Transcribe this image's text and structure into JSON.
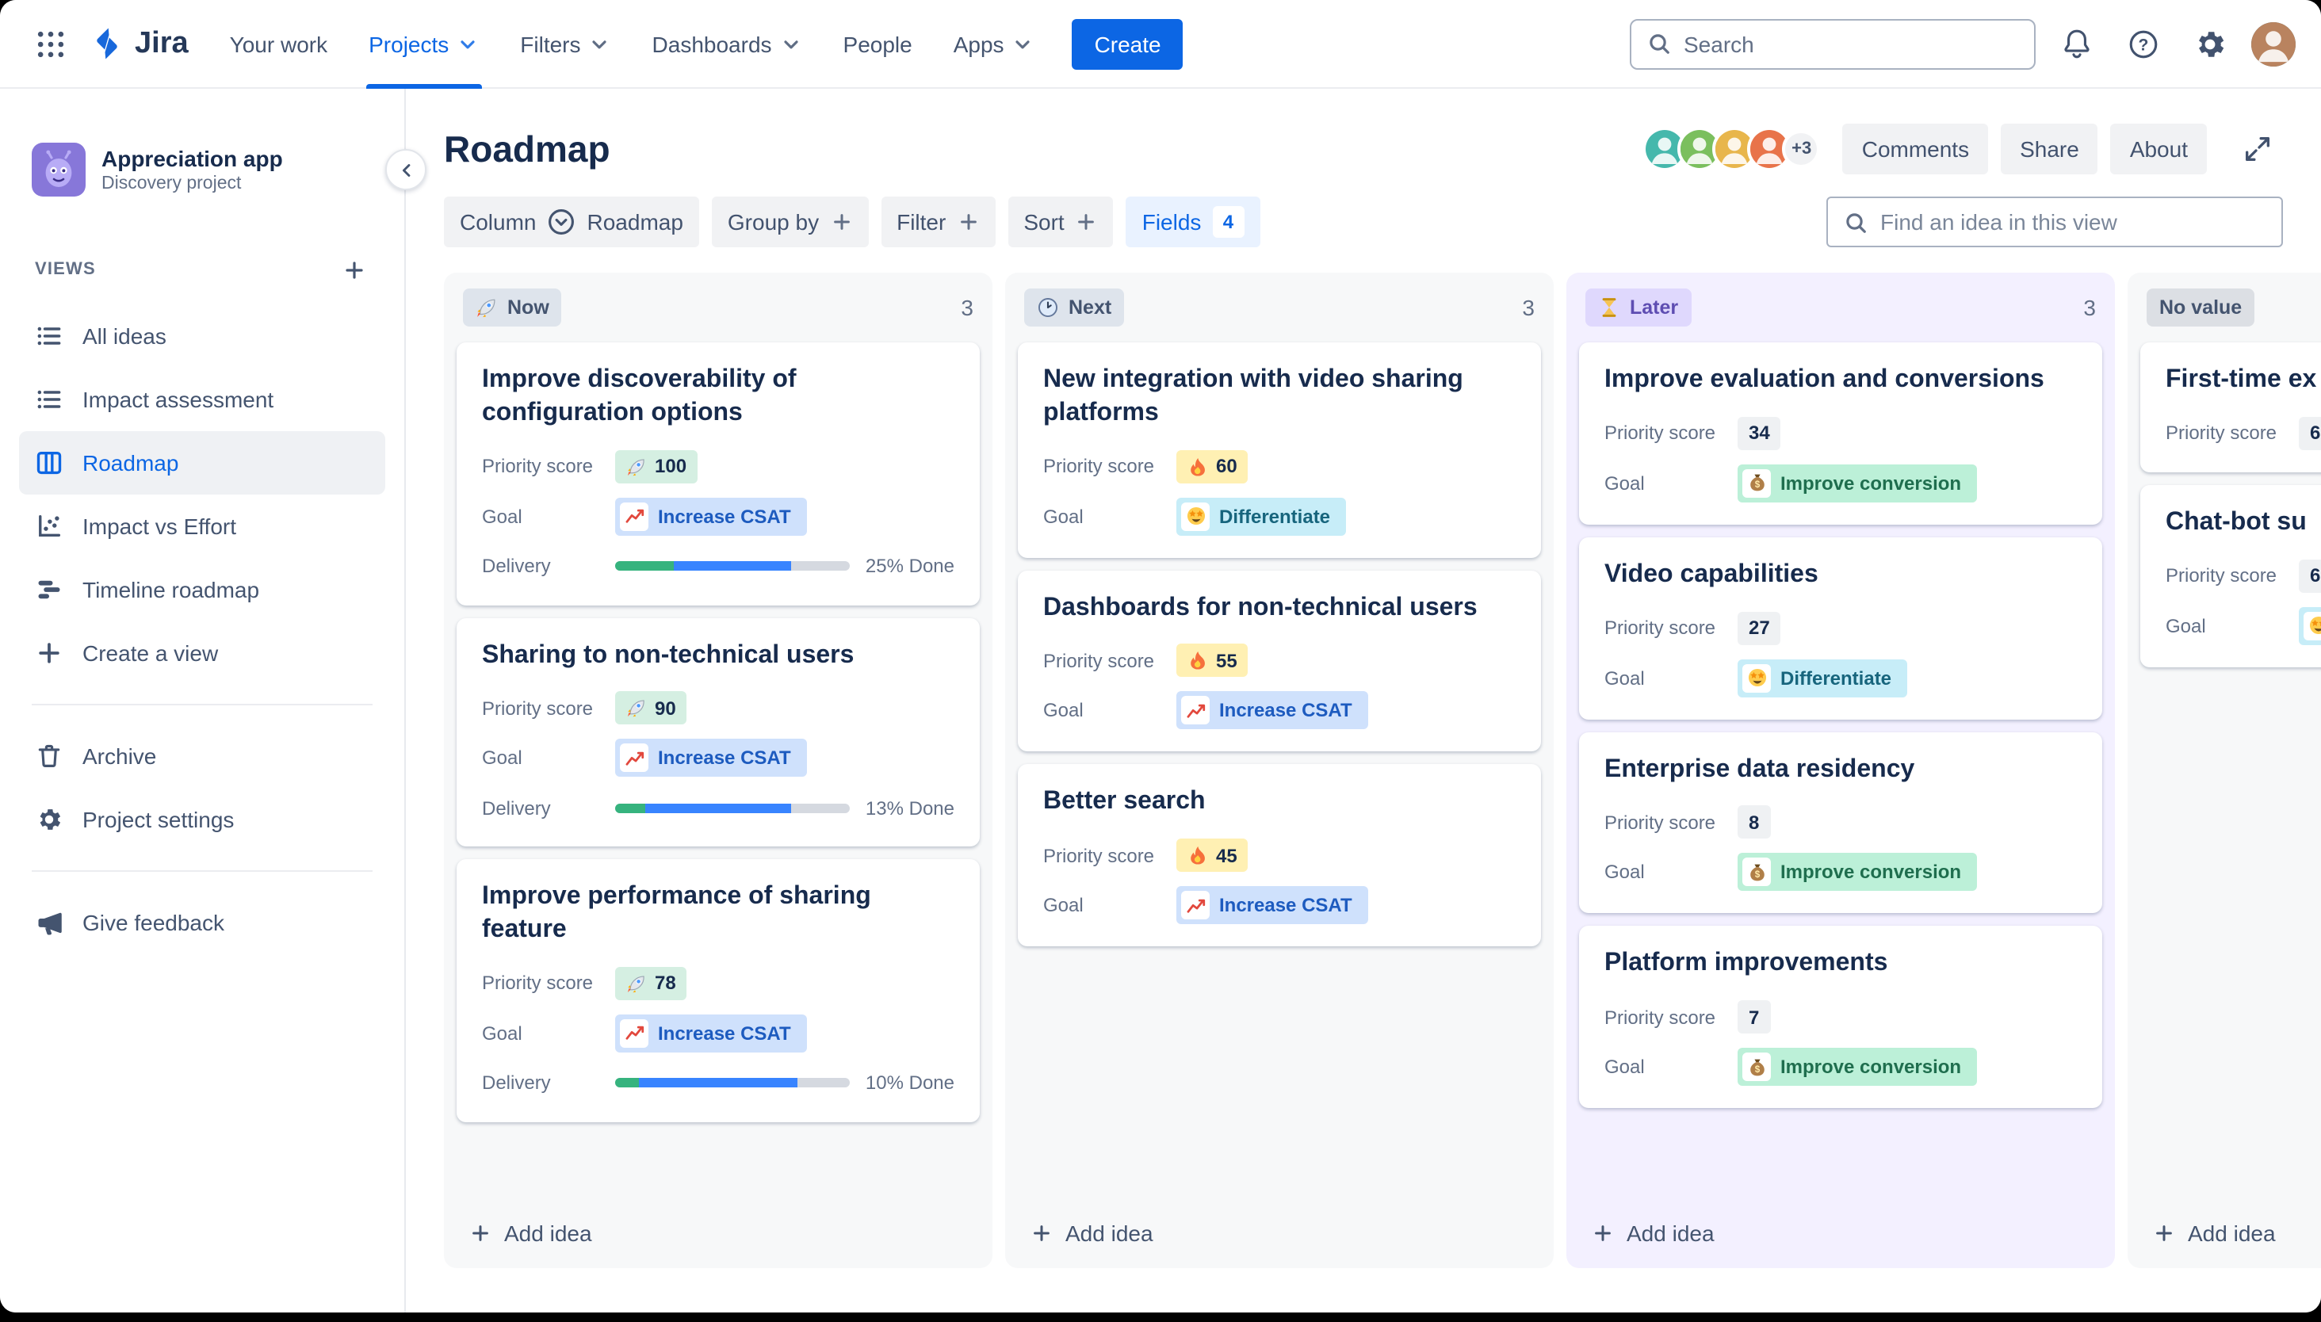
{
  "navbar": {
    "logo": "Jira",
    "items": [
      {
        "label": "Your work",
        "dropdown": false
      },
      {
        "label": "Projects",
        "dropdown": true,
        "active": true
      },
      {
        "label": "Filters",
        "dropdown": true
      },
      {
        "label": "Dashboards",
        "dropdown": true
      },
      {
        "label": "People",
        "dropdown": false
      },
      {
        "label": "Apps",
        "dropdown": true
      }
    ],
    "create_label": "Create",
    "search_placeholder": "Search"
  },
  "sidebar": {
    "project": {
      "name": "Appreciation app",
      "type": "Discovery project"
    },
    "views_heading": "VIEWS",
    "views": [
      {
        "label": "All ideas",
        "icon": "list-icon"
      },
      {
        "label": "Impact assessment",
        "icon": "list-icon"
      },
      {
        "label": "Roadmap",
        "icon": "board-icon",
        "active": true
      },
      {
        "label": "Impact vs Effort",
        "icon": "scatter-chart-icon"
      },
      {
        "label": "Timeline roadmap",
        "icon": "timeline-icon"
      }
    ],
    "create_view": "Create a view",
    "archive": "Archive",
    "project_settings": "Project settings",
    "give_feedback": "Give feedback"
  },
  "header": {
    "title": "Roadmap",
    "avatar_overflow": "+3",
    "comments": "Comments",
    "share": "Share",
    "about": "About"
  },
  "toolbar": {
    "column_label": "Column",
    "column_value": "Roadmap",
    "group_by": "Group by",
    "filter": "Filter",
    "sort": "Sort",
    "fields": "Fields",
    "fields_count": "4",
    "find_placeholder": "Find an idea in this view"
  },
  "board": {
    "labels": {
      "priority": "Priority score",
      "goal": "Goal",
      "delivery": "Delivery",
      "add_idea": "Add idea"
    },
    "columns": [
      {
        "name": "Now",
        "emoji": "rocket",
        "count": "3",
        "cards": [
          {
            "title": "Improve discoverability of configuration options",
            "priority": "100",
            "priority_emoji": "rocket",
            "goal": "Increase CSAT",
            "goal_emoji": "chart-increasing",
            "delivery_text": "25% Done",
            "delivery_done": 25,
            "delivery_progress": 50
          },
          {
            "title": "Sharing to non-technical users",
            "priority": "90",
            "priority_emoji": "rocket",
            "goal": "Increase CSAT",
            "goal_emoji": "chart-increasing",
            "delivery_text": "13% Done",
            "delivery_done": 13,
            "delivery_progress": 62
          },
          {
            "title": "Improve performance of sharing feature",
            "priority": "78",
            "priority_emoji": "rocket",
            "goal": "Increase CSAT",
            "goal_emoji": "chart-increasing",
            "delivery_text": "10% Done",
            "delivery_done": 10,
            "delivery_progress": 68
          }
        ]
      },
      {
        "name": "Next",
        "emoji": "clock",
        "count": "3",
        "cards": [
          {
            "title": "New integration with video sharing platforms",
            "priority": "60",
            "priority_emoji": "fire",
            "goal": "Differentiate",
            "goal_emoji": "star-struck"
          },
          {
            "title": "Dashboards for non-technical users",
            "priority": "55",
            "priority_emoji": "fire",
            "goal": "Increase CSAT",
            "goal_emoji": "chart-increasing"
          },
          {
            "title": "Better search",
            "priority": "45",
            "priority_emoji": "fire",
            "goal": "Increase CSAT",
            "goal_emoji": "chart-increasing"
          }
        ]
      },
      {
        "name": "Later",
        "emoji": "hourglass",
        "count": "3",
        "cards": [
          {
            "title": "Improve evaluation and conversions",
            "priority": "34",
            "goal": "Improve conversion",
            "goal_emoji": "money-bag"
          },
          {
            "title": "Video capabilities",
            "priority": "27",
            "goal": "Differentiate",
            "goal_emoji": "star-struck"
          },
          {
            "title": "Enterprise data residency",
            "priority": "8",
            "goal": "Improve conversion",
            "goal_emoji": "money-bag"
          },
          {
            "title": "Platform improvements",
            "priority": "7",
            "goal": "Improve conversion",
            "goal_emoji": "money-bag"
          }
        ]
      },
      {
        "name": "No value",
        "cards": [
          {
            "title": "First-time ex",
            "priority": "6"
          },
          {
            "title": "Chat-bot su",
            "priority": "6",
            "goal": "",
            "goal_emoji": "star-struck"
          }
        ]
      }
    ]
  },
  "colors": {
    "brand_blue": "#0C66E4",
    "column_bg": "#F7F8F9",
    "column_later_bg": "#F3F0FF",
    "later_badge_bg": "#DFD8FD",
    "score_high_bg": "#D5EFE2",
    "score_medium_bg": "#FFF0B3",
    "score_low_bg": "#EFF1F3",
    "goal_increase_csat_bg": "#CFE1FC",
    "goal_differentiate_bg": "#C7EDF8",
    "goal_improve_conversion_bg": "#BCF0D8",
    "progress_done": "#36B37E",
    "progress_in_progress": "#3884FF"
  }
}
